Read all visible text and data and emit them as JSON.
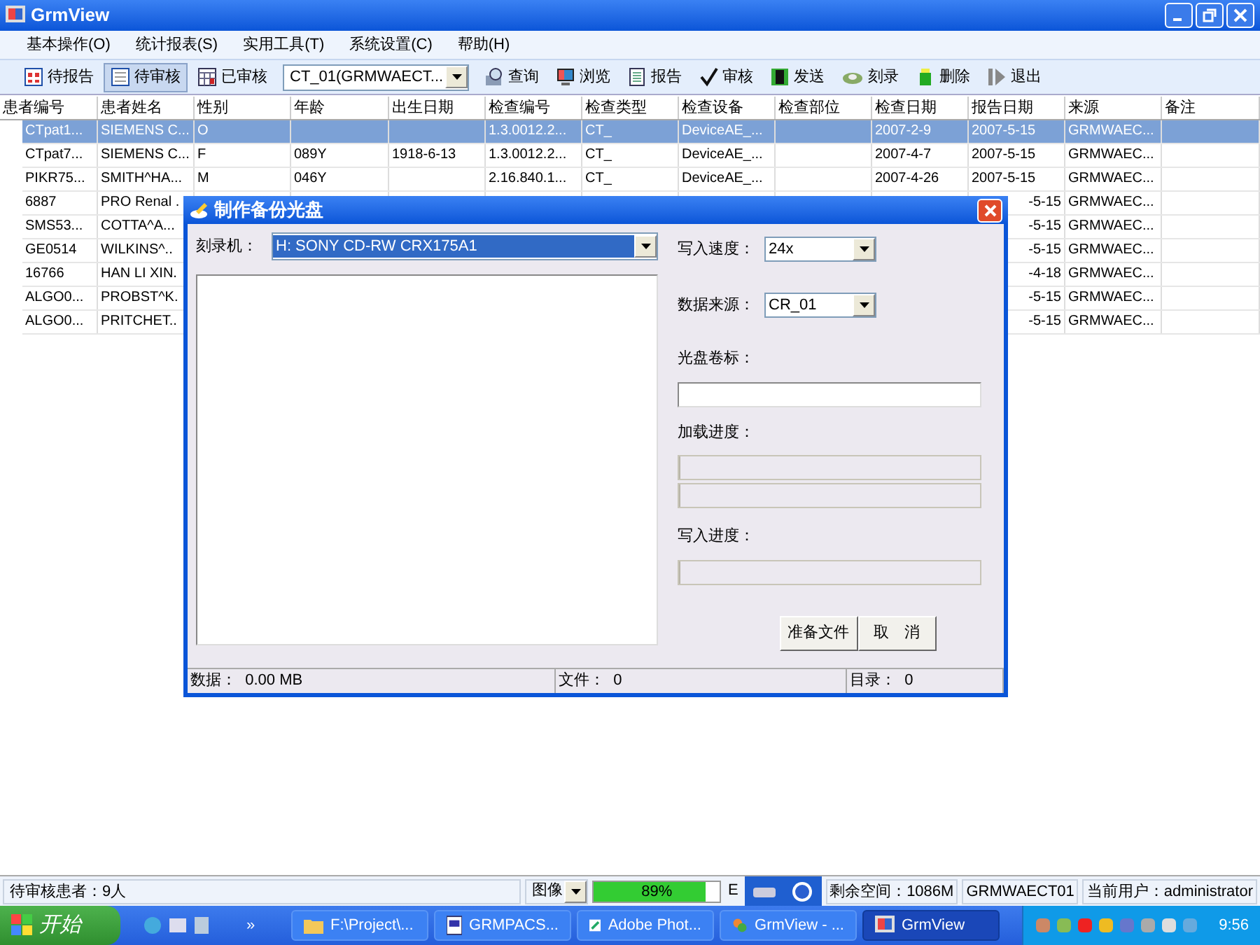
{
  "window": {
    "title": "GrmView"
  },
  "menu": [
    "基本操作(O)",
    "统计报表(S)",
    "实用工具(T)",
    "系统设置(C)",
    "帮助(H)"
  ],
  "toolbar": [
    {
      "kind": "button",
      "label": "待报告",
      "selected": false
    },
    {
      "kind": "button",
      "label": "待审核",
      "selected": true
    },
    {
      "kind": "button",
      "label": "已审核",
      "selected": false
    },
    {
      "kind": "combo",
      "label": "CT_01(GRMWAECT..."
    },
    {
      "kind": "button",
      "label": "查询",
      "selected": false
    },
    {
      "kind": "button",
      "label": "浏览",
      "selected": false
    },
    {
      "kind": "button",
      "label": "报告",
      "selected": false
    },
    {
      "kind": "button",
      "label": "审核",
      "selected": false
    },
    {
      "kind": "button",
      "label": "发送",
      "selected": false
    },
    {
      "kind": "button",
      "label": "刻录",
      "selected": false
    },
    {
      "kind": "button",
      "label": "删除",
      "selected": false
    },
    {
      "kind": "button",
      "label": "退出",
      "selected": false
    }
  ],
  "table": {
    "columns": [
      "患者编号",
      "患者姓名",
      "性别",
      "年龄",
      "出生日期",
      "检查编号",
      "检查类型",
      "检查设备",
      "检查部位",
      "检查日期",
      "报告日期",
      "来源",
      "备注"
    ],
    "rows": [
      {
        "selected": true,
        "cells": [
          "CTpat1...",
          "SIEMENS C...",
          "O",
          "",
          "",
          "1.3.0012.2...",
          "CT_",
          "DeviceAE_...",
          "",
          "2007-2-9",
          "2007-5-15",
          "GRMWAEC...",
          ""
        ]
      },
      {
        "selected": false,
        "cells": [
          "CTpat7...",
          "SIEMENS C...",
          "F",
          "089Y",
          "1918-6-13",
          "1.3.0012.2...",
          "CT_",
          "DeviceAE_...",
          "",
          "2007-4-7",
          "2007-5-15",
          "GRMWAEC...",
          ""
        ]
      },
      {
        "selected": false,
        "cells": [
          "PIKR75...",
          "SMITH^HA...",
          "M",
          "046Y",
          "",
          "2.16.840.1...",
          "CT_",
          "DeviceAE_...",
          "",
          "2007-4-26",
          "2007-5-15",
          "GRMWAEC...",
          ""
        ]
      },
      {
        "selected": false,
        "cells": [
          "6887",
          "PRO Renal .",
          null,
          null,
          null,
          null,
          null,
          null,
          null,
          null,
          "-5-15",
          "GRMWAEC...",
          ""
        ]
      },
      {
        "selected": false,
        "cells": [
          "SMS53...",
          "COTTA^A...",
          null,
          null,
          null,
          null,
          null,
          null,
          null,
          null,
          "-5-15",
          "GRMWAEC...",
          ""
        ]
      },
      {
        "selected": false,
        "cells": [
          "GE0514",
          "WILKINS^..",
          null,
          null,
          null,
          null,
          null,
          null,
          null,
          null,
          "-5-15",
          "GRMWAEC...",
          ""
        ]
      },
      {
        "selected": false,
        "cells": [
          "16766",
          "HAN LI XIN.",
          null,
          null,
          null,
          null,
          null,
          null,
          null,
          null,
          "-4-18",
          "GRMWAEC...",
          ""
        ]
      },
      {
        "selected": false,
        "cells": [
          "ALGO0...",
          "PROBST^K.",
          null,
          null,
          null,
          null,
          null,
          null,
          null,
          null,
          "-5-15",
          "GRMWAEC...",
          ""
        ]
      },
      {
        "selected": false,
        "cells": [
          "ALGO0...",
          "PRITCHET..",
          null,
          null,
          null,
          null,
          null,
          null,
          null,
          null,
          "-5-15",
          "GRMWAEC...",
          ""
        ]
      }
    ]
  },
  "dialog": {
    "title": "制作备份光盘",
    "burner": {
      "label": "刻录机：",
      "value": "H: SONY CD-RW  CRX175A1"
    },
    "speed": {
      "label": "写入速度：",
      "value": "24x"
    },
    "source": {
      "label": "数据来源：",
      "value": "CR_01"
    },
    "volume": {
      "label": "光盘卷标："
    },
    "load_progress": {
      "label": "加载进度：",
      "bars": [
        {
          "level": 0
        },
        {
          "level": 0
        }
      ]
    },
    "write_progress": {
      "label": "写入进度：",
      "level": 0
    },
    "buttons": [
      "准备文件",
      "取　消"
    ],
    "status": [
      "数据：  0.00 MB",
      "文件：  0",
      "目录：  0"
    ]
  },
  "status_bar": {
    "pending": "待审核患者：9人",
    "view": "图像",
    "progress": {
      "level": 0.89,
      "reading": "89%"
    },
    "letter": "E",
    "free_space": "剩余空间：1086M",
    "station": "GRMWAECT01",
    "user": "当前用户：administrator"
  },
  "taskbar": {
    "start": "开始",
    "more": "»",
    "tasks": [
      {
        "label": "F:\\Project\\...",
        "selected": false
      },
      {
        "label": "GRMPACS...",
        "selected": false
      },
      {
        "label": "Adobe Phot...",
        "selected": false
      },
      {
        "label": "GrmView - ...",
        "selected": false
      },
      {
        "label": "GrmView",
        "selected": true
      }
    ],
    "time": "9:56"
  }
}
